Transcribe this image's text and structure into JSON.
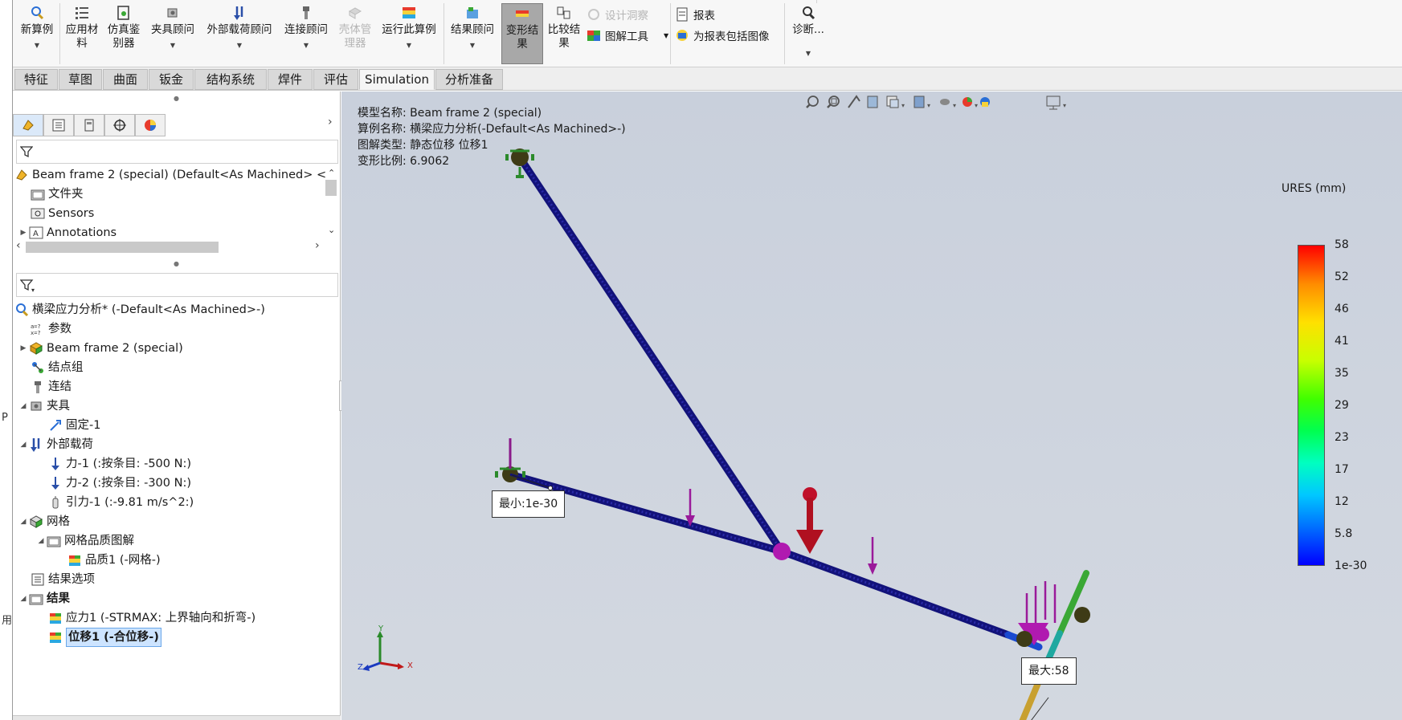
{
  "ribbon": {
    "new_study": "新算例",
    "apply_material": "应用材料",
    "apply_material_l1": "应用材",
    "apply_material_l2": "料",
    "simulation_evaluator_l1": "仿真鉴",
    "simulation_evaluator_l2": "别器",
    "fixtures_advisor": "夹具顾问",
    "external_loads_advisor": "外部载荷顾问",
    "connections_advisor": "连接顾问",
    "shell_manager_l1": "壳体管",
    "shell_manager_l2": "理器",
    "run_study": "运行此算例",
    "results_advisor": "结果顾问",
    "deformed_result_l1": "变形结",
    "deformed_result_l2": "果",
    "compare_results_l1": "比较结",
    "compare_results_l2": "果",
    "design_insight": "设计洞察",
    "plot_tools": "图解工具",
    "report": "报表",
    "include_image_report": "为报表包括图像",
    "diagnostics": "诊断..."
  },
  "tabs": [
    "特征",
    "草图",
    "曲面",
    "钣金",
    "结构系统",
    "焊件",
    "评估",
    "Simulation",
    "分析准备"
  ],
  "active_tab": "Simulation",
  "feature_tree": {
    "root": "Beam frame 2 (special) (Default<As Machined> <",
    "items": [
      "文件夹",
      "Sensors",
      "Annotations"
    ]
  },
  "study_tree": {
    "study": "横梁应力分析* (-Default<As Machined>-)",
    "params": "参数",
    "part": "Beam frame 2 (special)",
    "joint_groups": "结点组",
    "connections": "连结",
    "fixtures": "夹具",
    "fixed1": "固定-1",
    "external_loads": "外部载荷",
    "force1": "力-1 (:按条目: -500 N:)",
    "force2": "力-2 (:按条目: -300 N:)",
    "gravity1": "引力-1 (:-9.81 m/s^2:)",
    "mesh": "网格",
    "mesh_quality_plot": "网格品质图解",
    "quality1": "品质1 (-网格-)",
    "result_options": "结果选项",
    "results": "结果",
    "stress1": "应力1 (-STRMAX: 上界轴向和折弯-)",
    "displacement1": "位移1 (-合位移-)"
  },
  "viewport_info": {
    "model_name": "模型名称: Beam frame 2 (special)",
    "study_name": "算例名称: 横梁应力分析(-Default<As Machined>-)",
    "plot_type": "图解类型: 静态位移 位移1",
    "deform_scale": "变形比例: 6.9062"
  },
  "legend": {
    "title": "URES (mm)",
    "labels": [
      "58",
      "52",
      "46",
      "41",
      "35",
      "29",
      "23",
      "17",
      "12",
      "5.8",
      "1e-30"
    ],
    "colors": [
      "#ff0000",
      "#ff8c00",
      "#ffe000",
      "#c8ff00",
      "#40ff00",
      "#00ff50",
      "#00ffc0",
      "#00c8ff",
      "#0070ff",
      "#0020ff",
      "#0000ff"
    ]
  },
  "callouts": {
    "min": "最小:1e-30",
    "max": "最大:58"
  },
  "triad": {
    "x": "X",
    "y": "Y",
    "z": "Z"
  },
  "edge_chars": [
    "P",
    "用"
  ]
}
